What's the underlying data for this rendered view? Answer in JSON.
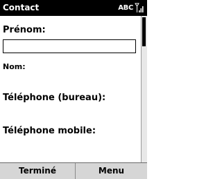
{
  "titlebar": {
    "title": "Contact",
    "input_mode": "ABC",
    "signal_icon": "signal-strength-icon"
  },
  "form": {
    "fields": [
      {
        "label": "Prénom:",
        "value": ""
      },
      {
        "label": "Nom:"
      },
      {
        "label": "Téléphone (bureau):"
      },
      {
        "label": "Téléphone mobile:"
      }
    ]
  },
  "softkeys": {
    "left": "Terminé",
    "right": "Menu"
  },
  "colors": {
    "titlebar_bg": "#000000",
    "softkey_bg": "#d6d6d6",
    "background": "#ffffff"
  }
}
